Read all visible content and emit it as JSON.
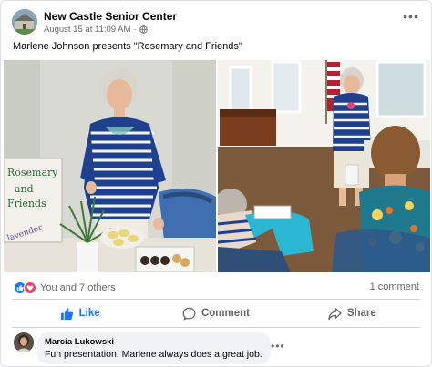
{
  "post": {
    "page_name": "New Castle Senior Center",
    "date": "August 15 at 11:09 AM",
    "separator": "·",
    "caption": "Marlene Johnson presents \"Rosemary and Friends\"",
    "more_icon": "more-horizontal-icon",
    "privacy_icon": "globe-icon"
  },
  "photos": {
    "left_sign_lines": [
      "Rosemary",
      "and",
      "Friends",
      "lavender"
    ],
    "left_alt": "Woman in striped shirt standing beside a table with a sign, herbs and treats",
    "right_alt": "Woman presenting in front of a seated audience in a room with a flag and piano"
  },
  "reactions": {
    "summary": "You and 7 others",
    "icons": [
      "like-icon",
      "love-icon"
    ],
    "comment_count": "1 comment"
  },
  "actions": {
    "like": "Like",
    "comment": "Comment",
    "share": "Share"
  },
  "comment": {
    "author": "Marcia Lukowski",
    "text": "Fun presentation. Marlene always does a great job."
  },
  "colors": {
    "brand_blue": "#1877f2",
    "love_red": "#f33e58",
    "secondary_text": "#65676b",
    "bubble_bg": "#f0f2f5"
  }
}
